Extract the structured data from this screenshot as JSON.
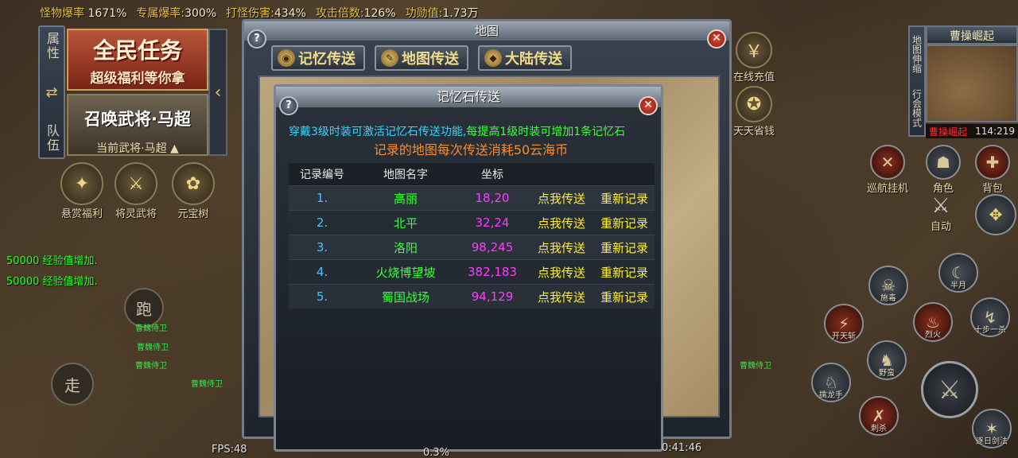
{
  "top_stats": [
    {
      "label": "怪物爆率",
      "value": "1671%"
    },
    {
      "label": "专属爆率:",
      "value": "300%"
    },
    {
      "label": "打怪伤害:",
      "value": "434%"
    },
    {
      "label": "攻击倍数:",
      "value": "126%"
    },
    {
      "label": "功勋值:",
      "value": "1.73万"
    }
  ],
  "left_panel": {
    "tab_attr": "属性",
    "tab_team": "队伍",
    "quest_title": "全民任务",
    "quest_sub": "超级福利等你拿",
    "summon_title": "召唤武将·马超",
    "summon_current": "当前武将·马超"
  },
  "left_icons": [
    {
      "label": "悬赏福利",
      "icon": "reward-icon"
    },
    {
      "label": "将灵武将",
      "icon": "general-icon"
    },
    {
      "label": "元宝树",
      "icon": "tree-icon"
    }
  ],
  "exp_messages": [
    "50000 经验值增加.",
    "50000 经验值增加."
  ],
  "joystick": {
    "run": "跑",
    "walk": "走"
  },
  "map_window": {
    "title": "地图",
    "tabs": [
      "记忆传送",
      "地图传送",
      "大陆传送"
    ]
  },
  "memory_window": {
    "title": "记忆石传送",
    "notice_part1": "穿戴3级时装可激活记忆石传送功能,",
    "notice_part2": "每提高1级时装可增加1条记忆石",
    "notice_line2": "记录的地图每次传送消耗50云海币",
    "headers": {
      "no": "记录编号",
      "name": "地图名字",
      "coord": "坐标"
    },
    "rows": [
      {
        "no": "1.",
        "name": "高丽",
        "coord": "18,20",
        "go": "点我传送",
        "rerecord": "重新记录"
      },
      {
        "no": "2.",
        "name": "北平",
        "coord": "32,24",
        "go": "点我传送",
        "rerecord": "重新记录"
      },
      {
        "no": "3.",
        "name": "洛阳",
        "coord": "98,245",
        "go": "点我传送",
        "rerecord": "重新记录"
      },
      {
        "no": "4.",
        "name": "火烧博望坡",
        "coord": "382,183",
        "go": "点我传送",
        "rerecord": "重新记录"
      },
      {
        "no": "5.",
        "name": "蜀国战场",
        "coord": "94,129",
        "go": "点我传送",
        "rerecord": "重新记录"
      }
    ]
  },
  "right_top": [
    {
      "label": "在线充值",
      "icon": "recharge-icon"
    },
    {
      "label": "天天省钱",
      "icon": "savings-icon"
    }
  ],
  "minimap": {
    "title": "曹操崛起",
    "side_1": "地图伸缩",
    "side_2": "行会模式",
    "coord": "114:219",
    "red_text": "曹操崛起"
  },
  "right_buttons": [
    {
      "label": "巡航挂机",
      "icon": "cruise-icon"
    },
    {
      "label": "角色",
      "icon": "character-icon"
    },
    {
      "label": "背包",
      "icon": "bag-icon"
    },
    {
      "label": "自动",
      "icon": "auto-icon"
    }
  ],
  "skills": [
    {
      "label": "半月",
      "icon": "halfmoon-icon"
    },
    {
      "label": "施毒",
      "icon": "poison-icon"
    },
    {
      "label": "开天斩",
      "icon": "heaven-slash-icon"
    },
    {
      "label": "烈火",
      "icon": "fire-icon"
    },
    {
      "label": "十步一杀",
      "icon": "tenstep-icon"
    },
    {
      "label": "野蛮",
      "icon": "barbarian-icon"
    },
    {
      "label": "擒龙手",
      "icon": "dragon-hand-icon"
    },
    {
      "label": "刺杀",
      "icon": "assassinate-icon"
    },
    {
      "label": "逐日剑法",
      "icon": "sun-sword-icon"
    }
  ],
  "bottom": {
    "fps": "FPS:48",
    "percent": "0.3%",
    "time": "0:41:46"
  },
  "mob_names": [
    "曹魏侍卫",
    "曹魏侍卫",
    "曹魏侍卫",
    "曹魏侍卫",
    "曹魏侍卫"
  ]
}
